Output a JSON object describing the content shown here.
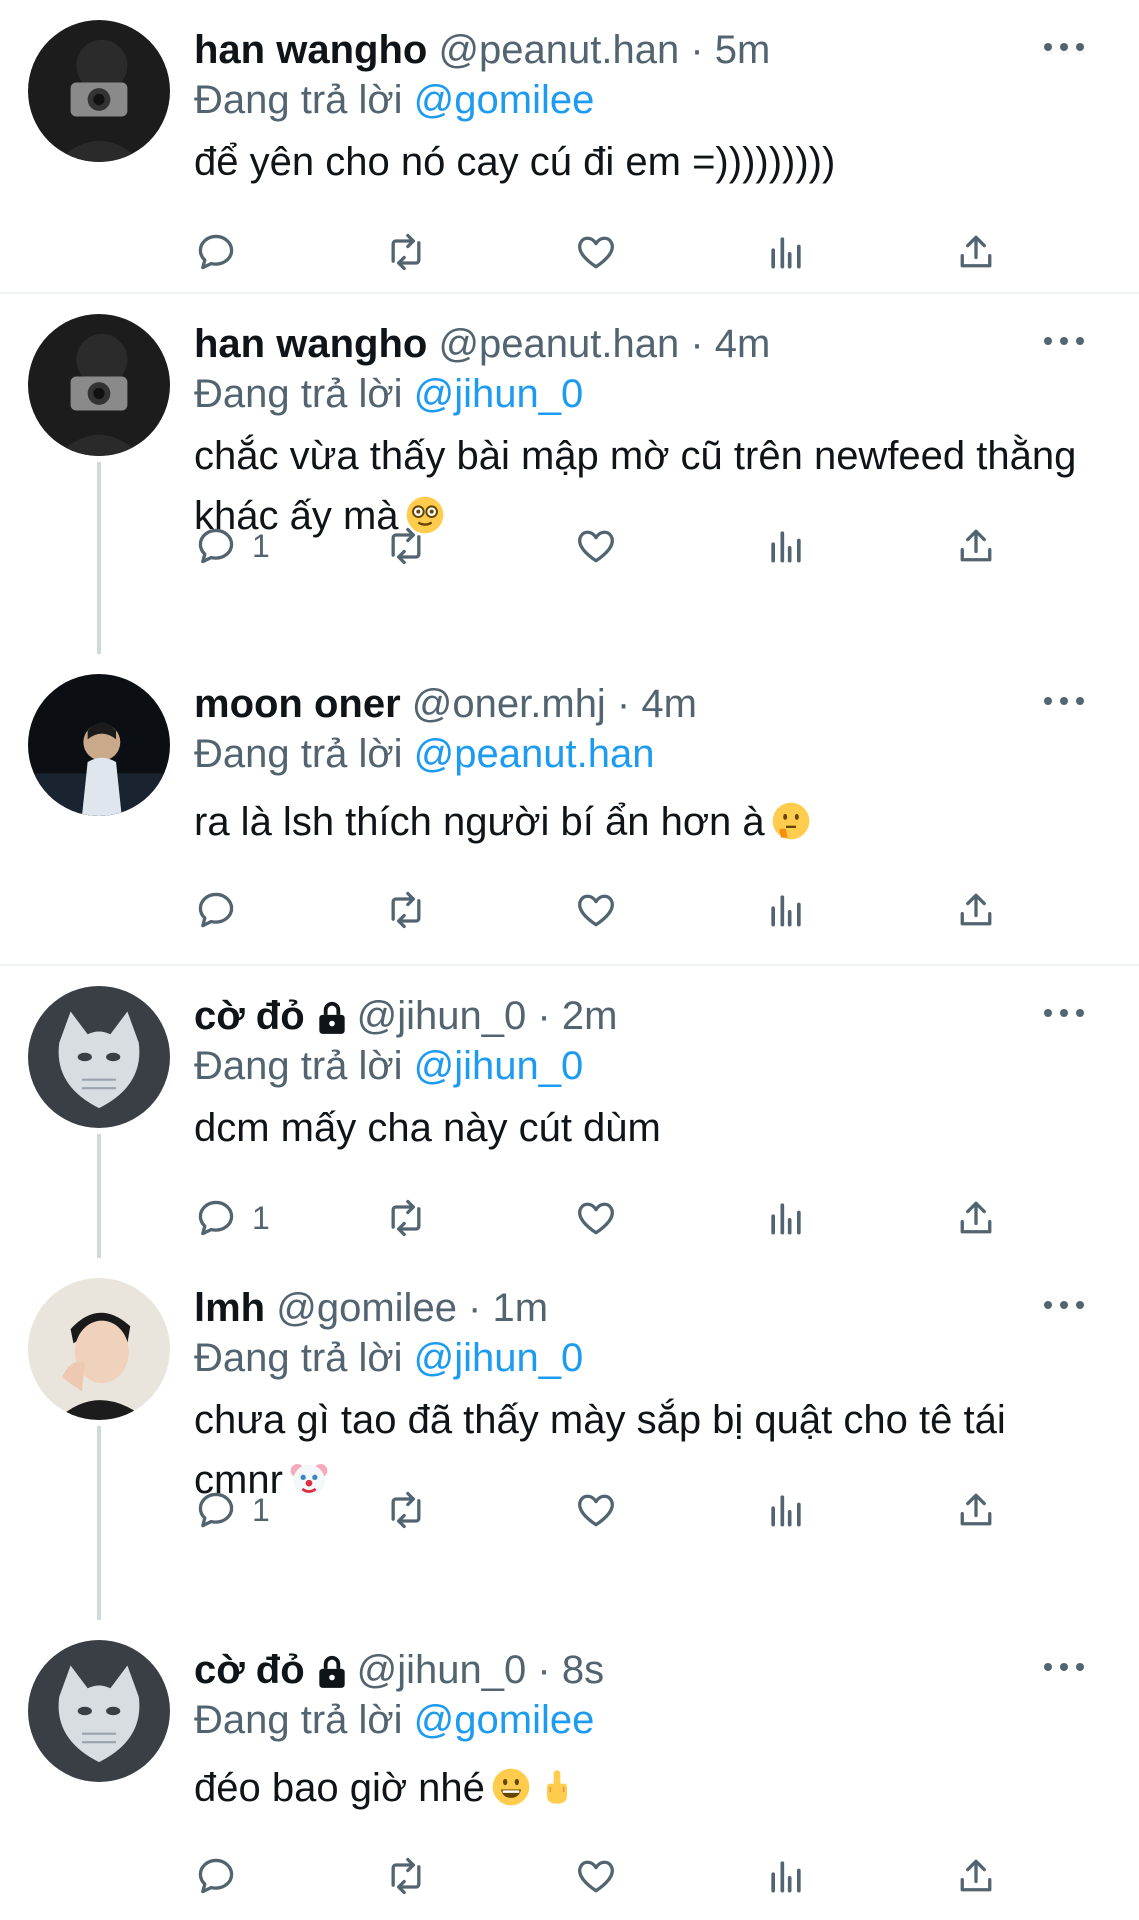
{
  "tweets": [
    {
      "name": "han wangho",
      "locked": false,
      "handle": "@peanut.han · 5m",
      "replying_prefix": "Đang trả lời ",
      "replying_to": "@gomilee",
      "text": "để yên cho nó cay cú đi em =)))))))))",
      "emoji": "",
      "reply_count": ""
    },
    {
      "name": "han wangho",
      "locked": false,
      "handle": "@peanut.han · 4m",
      "replying_prefix": "Đang trả lời ",
      "replying_to": "@jihun_0",
      "text": "chắc vừa thấy bài mập mờ cũ trên newfeed thằng khác ấy mà",
      "emoji": "nerd-face",
      "reply_count": "1"
    },
    {
      "name": "moon oner",
      "locked": false,
      "handle": "@oner.mhj · 4m",
      "replying_prefix": "Đang trả lời ",
      "replying_to": "@peanut.han",
      "text": "ra là lsh thích người bí ẩn hơn à",
      "emoji": "thinking-face",
      "reply_count": ""
    },
    {
      "name": "cờ đỏ",
      "locked": true,
      "handle": "@jihun_0 · 2m",
      "replying_prefix": "Đang trả lời ",
      "replying_to": "@jihun_0",
      "text": "dcm mấy cha này cút dùm",
      "emoji": "",
      "reply_count": "1"
    },
    {
      "name": "lmh",
      "locked": false,
      "handle": "@gomilee · 1m",
      "replying_prefix": "Đang trả lời ",
      "replying_to": "@jihun_0",
      "text": "chưa gì tao đã thấy mày sắp bị quật cho tê tái cmnr",
      "emoji": "clown-face",
      "reply_count": "1"
    },
    {
      "name": "cờ đỏ",
      "locked": true,
      "handle": "@jihun_0 · 8s",
      "replying_prefix": "Đang trả lời ",
      "replying_to": "@gomilee",
      "text": "đéo bao giờ nhé",
      "emoji": "grin-face middle-finger",
      "reply_count": ""
    }
  ],
  "colors": {
    "accent": "#1d9bf0",
    "muted": "#536471",
    "text": "#0f1419"
  }
}
